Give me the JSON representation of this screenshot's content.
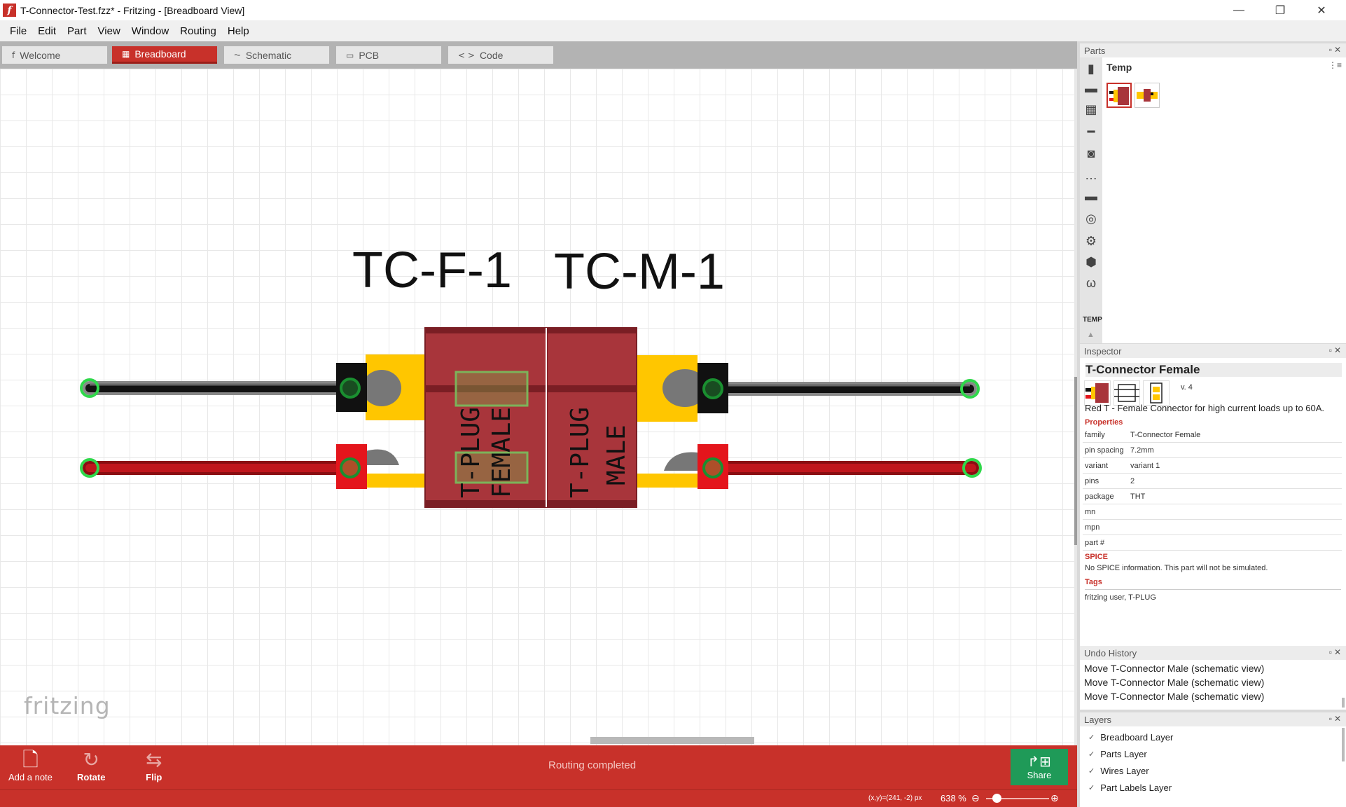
{
  "window": {
    "title": "T-Connector-Test.fzz* - Fritzing - [Breadboard View]",
    "app_icon": "f",
    "controls": {
      "minimize": "—",
      "maximize": "❐",
      "close": "✕"
    }
  },
  "menu": [
    "File",
    "Edit",
    "Part",
    "View",
    "Window",
    "Routing",
    "Help"
  ],
  "tabs": [
    {
      "label": "Welcome",
      "icon": "fritzing-logo-icon",
      "glyph": "f"
    },
    {
      "label": "Breadboard",
      "icon": "breadboard-icon",
      "glyph": "▦",
      "active": true
    },
    {
      "label": "Schematic",
      "icon": "resistor-icon",
      "glyph": "⏦"
    },
    {
      "label": "PCB",
      "icon": "chip-icon",
      "glyph": "▭"
    },
    {
      "label": "Code",
      "icon": "code-icon",
      "glyph": "< >"
    }
  ],
  "canvas": {
    "watermark": "fritzing",
    "labels": {
      "female": "TC-F-1",
      "male": "TC-M-1"
    },
    "body_text": {
      "female_line1": "T-PLUG",
      "female_line2": "FEMALE",
      "male_line1": "T-PLUG",
      "male_line2": "MALE"
    },
    "colors": {
      "body": "#a8353b",
      "body_dark": "#7a1e24",
      "yellow": "#ffc600",
      "wire_black": "#111111",
      "wire_red": "#c0161c",
      "connector_green": "#2fd84a"
    }
  },
  "bottom_toolbar": {
    "tools": [
      {
        "label": "Add a note",
        "icon": "note-icon",
        "glyph": "🗋"
      },
      {
        "label": "Rotate",
        "icon": "rotate-icon",
        "glyph": "↻"
      },
      {
        "label": "Flip",
        "icon": "flip-icon",
        "glyph": "⇆"
      }
    ],
    "status": "Routing completed",
    "share": {
      "label": "Share",
      "icon": "share-icon",
      "glyph": "↱⊞"
    }
  },
  "statusbar": {
    "coords": "(x,y)=(241, -2) px",
    "zoom": "638 %",
    "zoom_out": "⊖",
    "zoom_in": "⊕",
    "zoom_fraction": 0.17
  },
  "parts": {
    "header": "Parts",
    "bin_title": "Temp",
    "bin_label": "TEMP",
    "bin_icons": [
      "ic-icon",
      "servo-icon",
      "chip-icon",
      "resistor-icon",
      "speaker-icon",
      "dots-icon",
      "display-icon",
      "antenna-icon",
      "motor-icon",
      "hexagon-icon",
      "wire-icon"
    ],
    "panel_ctrls": "▫✕"
  },
  "inspector": {
    "header": "Inspector",
    "title": "T-Connector Female",
    "version": "v. 4",
    "description": "Red T - Female Connector for high current loads up to 60A.",
    "properties_heading": "Properties",
    "properties": [
      {
        "key": "family",
        "value": "T-Connector Female"
      },
      {
        "key": "pin spacing",
        "value": "7.2mm"
      },
      {
        "key": "variant",
        "value": "variant 1"
      },
      {
        "key": "pins",
        "value": "2"
      },
      {
        "key": "package",
        "value": "THT"
      },
      {
        "key": "mn",
        "value": ""
      },
      {
        "key": "mpn",
        "value": ""
      },
      {
        "key": "part #",
        "value": ""
      }
    ],
    "spice_heading": "SPICE",
    "spice_text": "No SPICE information. This part will not be simulated.",
    "tags_heading": "Tags",
    "tags": "fritzing user, T-PLUG"
  },
  "undo": {
    "header": "Undo History",
    "items": [
      "Move T-Connector Male (schematic view)",
      "Move T-Connector Male (schematic view)",
      "Move T-Connector Male (schematic view)"
    ]
  },
  "layers": {
    "header": "Layers",
    "items": [
      "Breadboard Layer",
      "Parts Layer",
      "Wires Layer",
      "Part Labels Layer"
    ],
    "check": "✓"
  }
}
